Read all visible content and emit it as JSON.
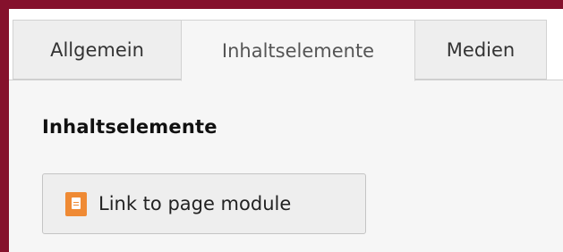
{
  "tabs": [
    {
      "label": "Allgemein",
      "active": false
    },
    {
      "label": "Inhaltselemente",
      "active": true
    },
    {
      "label": "Medien",
      "active": false
    }
  ],
  "panel": {
    "section_title": "Inhaltselemente",
    "button": {
      "label": "Link to page module",
      "icon": "page-icon"
    }
  },
  "colors": {
    "frame_accent": "#85112c",
    "panel_background": "#f6f6f6",
    "icon_orange": "#ef8a34"
  }
}
